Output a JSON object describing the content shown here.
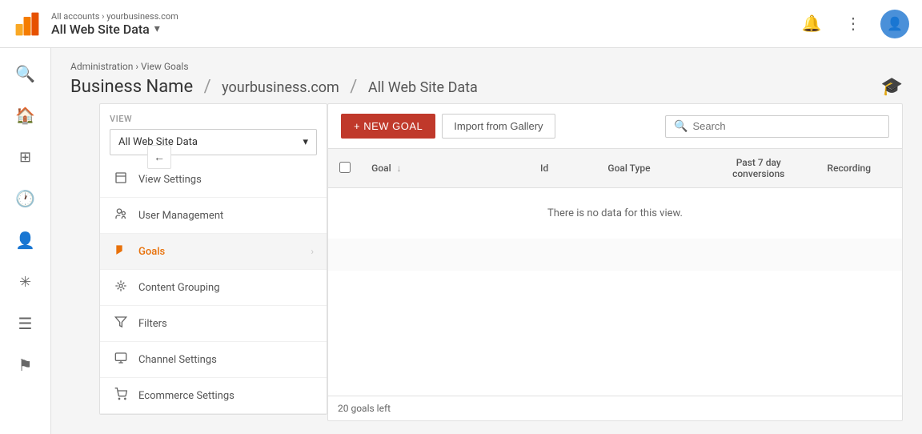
{
  "top_header": {
    "breadcrumb": "All accounts › yourbusiness.com",
    "title": "All Web Site Data",
    "dropdown_arrow": "▾",
    "notification_icon": "🔔",
    "more_icon": "⋮"
  },
  "page_header": {
    "breadcrumb_admin": "Administration",
    "breadcrumb_sep": "›",
    "breadcrumb_view": "View Goals",
    "page_title": "Business Name",
    "separator": "/",
    "subdomain": "yourbusiness.com",
    "separator2": "/",
    "site_data": "All Web Site Data"
  },
  "view_section": {
    "label": "VIEW",
    "selected": "All Web Site Data"
  },
  "nav_items": [
    {
      "id": "view-settings",
      "label": "View Settings",
      "icon": "📄"
    },
    {
      "id": "user-management",
      "label": "User Management",
      "icon": "👥"
    },
    {
      "id": "goals",
      "label": "Goals",
      "icon": "🚩",
      "active": true
    },
    {
      "id": "content-grouping",
      "label": "Content Grouping",
      "icon": "⚙"
    },
    {
      "id": "filters",
      "label": "Filters",
      "icon": "▽"
    },
    {
      "id": "channel-settings",
      "label": "Channel Settings",
      "icon": "📊"
    },
    {
      "id": "ecommerce-settings",
      "label": "Ecommerce Settings",
      "icon": "🛒"
    }
  ],
  "goals_panel": {
    "new_goal_label": "+ NEW GOAL",
    "import_label": "Import from Gallery",
    "search_placeholder": "Search",
    "table": {
      "headers": [
        "",
        "Goal",
        "Id",
        "Goal Type",
        "Past 7 day conversions",
        "Recording"
      ],
      "no_data_text": "There is no data for this view.",
      "footer": "20 goals left"
    }
  },
  "sidebar_icons": [
    {
      "id": "search",
      "icon": "🔍"
    },
    {
      "id": "home",
      "icon": "🏠"
    },
    {
      "id": "dashboard",
      "icon": "⊞"
    },
    {
      "id": "clock",
      "icon": "🕐"
    },
    {
      "id": "person",
      "icon": "👤"
    },
    {
      "id": "target",
      "icon": "🎯"
    },
    {
      "id": "list",
      "icon": "☰"
    },
    {
      "id": "flag",
      "icon": "⚑"
    }
  ],
  "colors": {
    "active_color": "#e8710a",
    "header_bg": "#ffffff",
    "btn_new_goal": "#c0392b"
  }
}
